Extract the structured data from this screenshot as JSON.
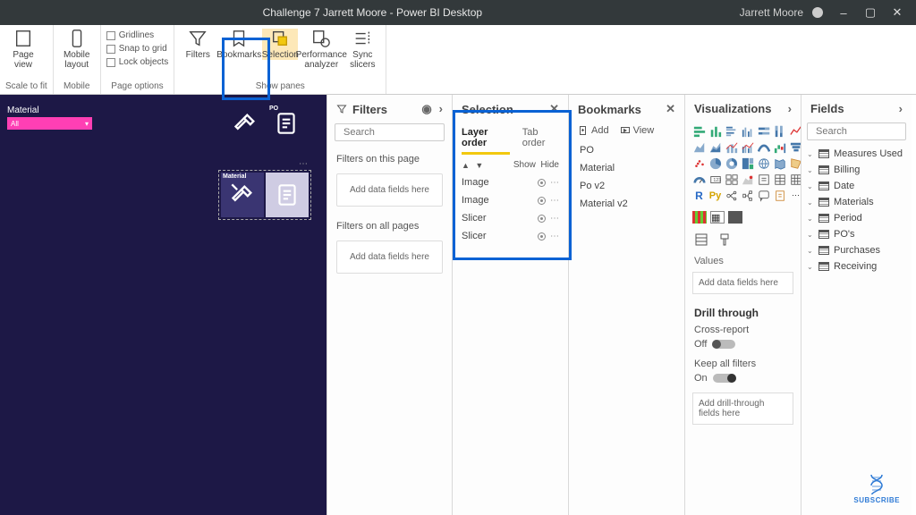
{
  "titlebar": {
    "title": "Challenge 7 Jarrett Moore - Power BI Desktop",
    "user": "Jarrett Moore"
  },
  "ribbon": {
    "groups": {
      "scale": {
        "label": "Scale to fit",
        "page_view": "Page view"
      },
      "mobile": {
        "label": "Mobile",
        "layout": "Mobile layout"
      },
      "page_options": {
        "label": "Page options",
        "gridlines": "Gridlines",
        "snap": "Snap to grid",
        "lock": "Lock objects"
      },
      "show_panes": {
        "label": "Show panes",
        "filters": "Filters",
        "bookmarks": "Bookmarks",
        "selection": "Selection",
        "perf": "Performance analyzer",
        "sync": "Sync slicers"
      }
    }
  },
  "canvas": {
    "slicer": {
      "title": "Material",
      "value": "All"
    },
    "tile2_label": "Material",
    "tile1_po": "PO"
  },
  "filters": {
    "title": "Filters",
    "search_placeholder": "Search",
    "this_page": "Filters on this page",
    "all_pages": "Filters on all pages",
    "dropzone": "Add data fields here"
  },
  "selection": {
    "title": "Selection",
    "tab_layer": "Layer order",
    "tab_tab": "Tab order",
    "show": "Show",
    "hide": "Hide",
    "items": [
      "Image",
      "Image",
      "Slicer",
      "Slicer"
    ]
  },
  "bookmarks": {
    "title": "Bookmarks",
    "add": "Add",
    "view": "View",
    "items": [
      "PO",
      "Material",
      "Po v2",
      "Material v2"
    ]
  },
  "viz": {
    "title": "Visualizations",
    "values_label": "Values",
    "values_drop": "Add data fields here",
    "drill_title": "Drill through",
    "cross": "Cross-report",
    "off": "Off",
    "keep": "Keep all filters",
    "on": "On",
    "drill_drop": "Add drill-through fields here"
  },
  "fields": {
    "title": "Fields",
    "search_placeholder": "Search",
    "tables": [
      "Measures Used",
      "Billing",
      "Date",
      "Materials",
      "Period",
      "PO's",
      "Purchases",
      "Receiving"
    ]
  },
  "subscribe": "SUBSCRIBE"
}
